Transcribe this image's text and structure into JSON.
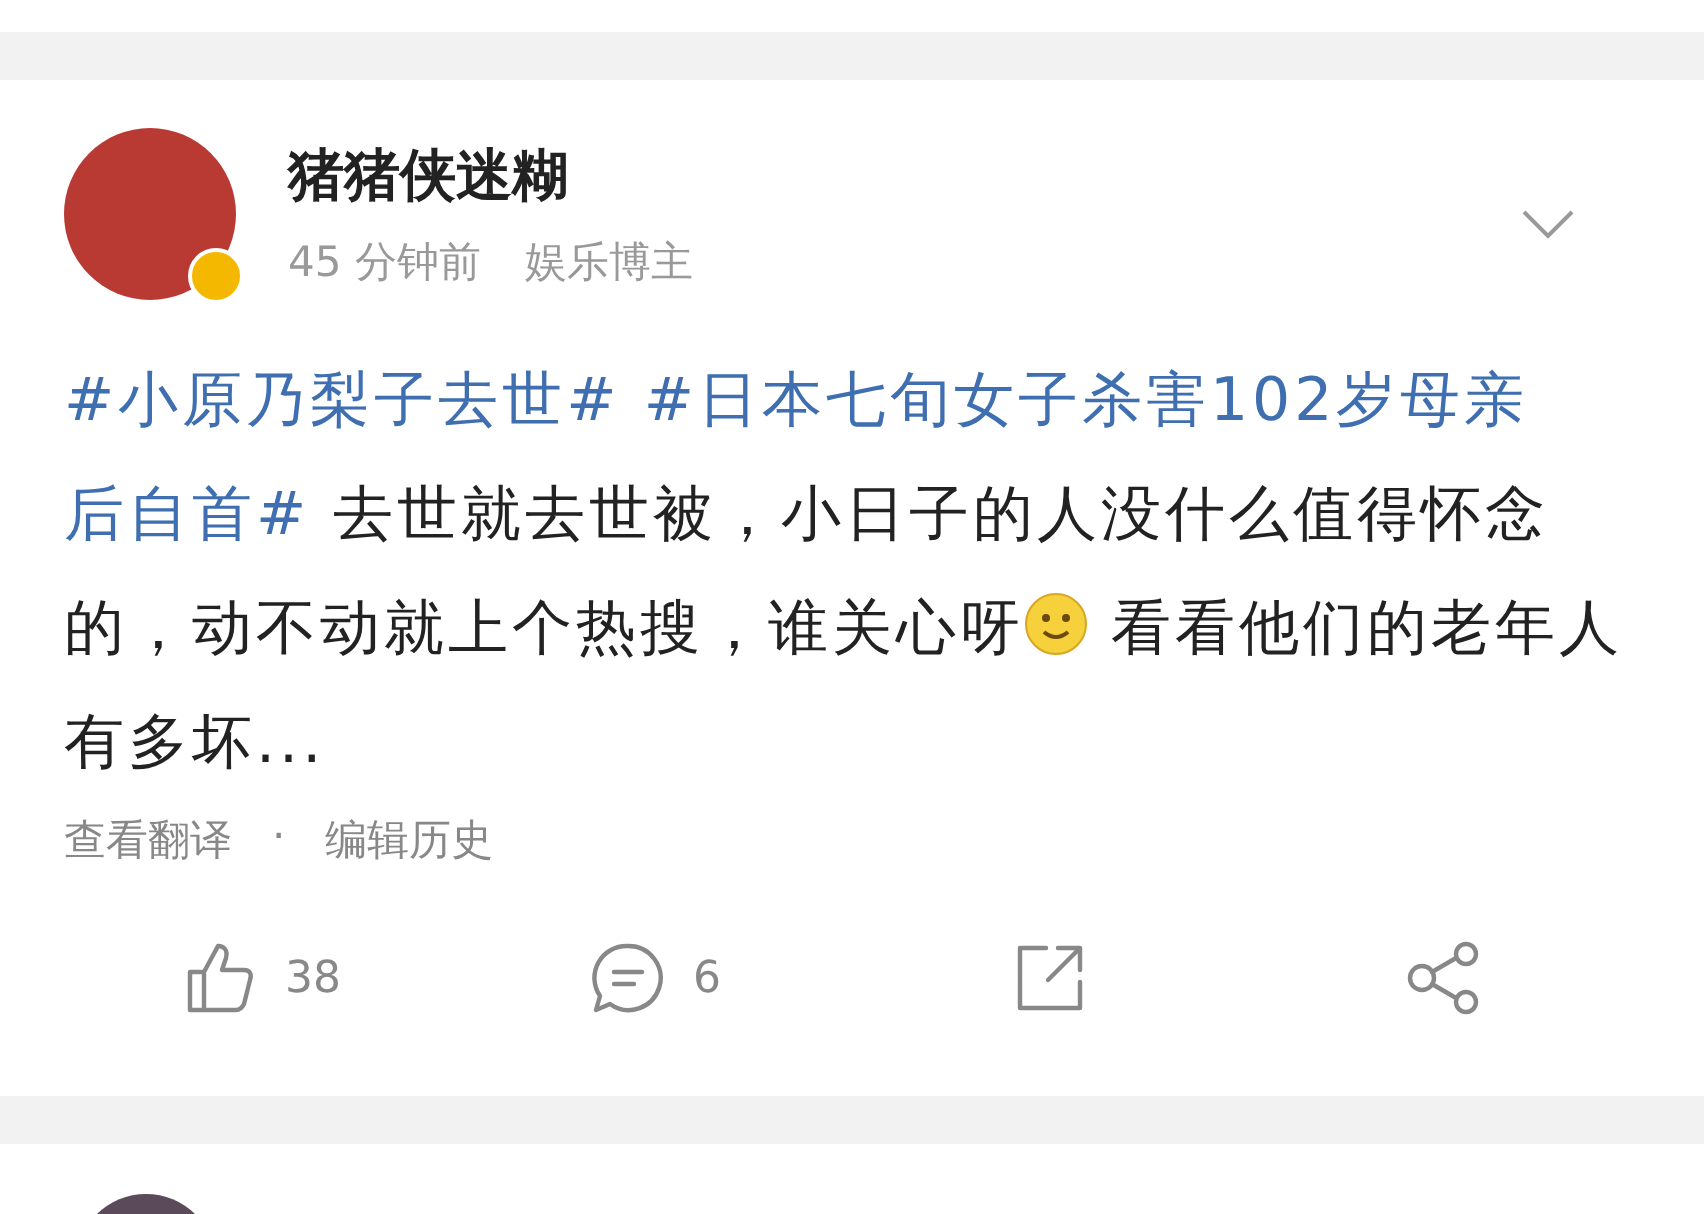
{
  "post": {
    "author": "猪猪侠迷糊",
    "verified": true,
    "time": "45 分钟前",
    "author_tag": "娱乐博主",
    "content": [
      {
        "kind": "hashtag",
        "text": "#小原乃梨子去世#"
      },
      {
        "kind": "hashtag",
        "text": "#日本七旬女子杀害102岁母亲",
        "continued": true
      },
      {
        "kind": "hashtag",
        "text": "后自首#"
      },
      {
        "kind": "text",
        "text": " 去世就去世被，小日子的人没什么值得怀念的，动不动就上个热搜，谁关心呀"
      },
      {
        "kind": "emoji"
      },
      {
        "kind": "text",
        "text": " 看看他们的老年人有多坏..."
      }
    ],
    "links": [
      "查看翻译",
      "编辑历史"
    ],
    "link_separator": "·",
    "actions": [
      {
        "kind": "like",
        "count": "38"
      },
      {
        "kind": "comment",
        "count": "6"
      },
      {
        "kind": "repost"
      },
      {
        "kind": "share"
      }
    ]
  }
}
